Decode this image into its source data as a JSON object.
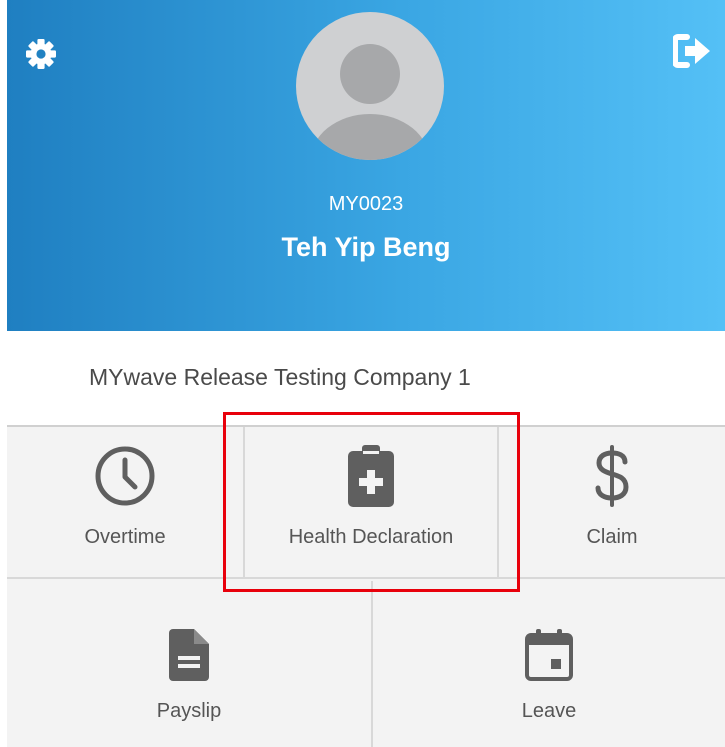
{
  "header": {
    "employee_id": "MY0023",
    "employee_name": "Teh Yip Beng",
    "settings_icon": "gear-icon",
    "logout_icon": "sign-out-icon",
    "gradient_colors": [
      "#1f7fc1",
      "#54c0f6"
    ]
  },
  "company": {
    "name": "MYwave Release Testing Company 1"
  },
  "menu": {
    "overtime": {
      "label": "Overtime",
      "icon": "clock-icon"
    },
    "health_declaration": {
      "label": "Health Declaration",
      "icon": "medical-clipboard-icon"
    },
    "claim": {
      "label": "Claim",
      "icon": "dollar-icon"
    },
    "payslip": {
      "label": "Payslip",
      "icon": "document-icon"
    },
    "leave": {
      "label": "Leave",
      "icon": "calendar-icon"
    }
  },
  "colors": {
    "icon_gray": "#5f5f5f",
    "highlight": "#e8000b"
  }
}
